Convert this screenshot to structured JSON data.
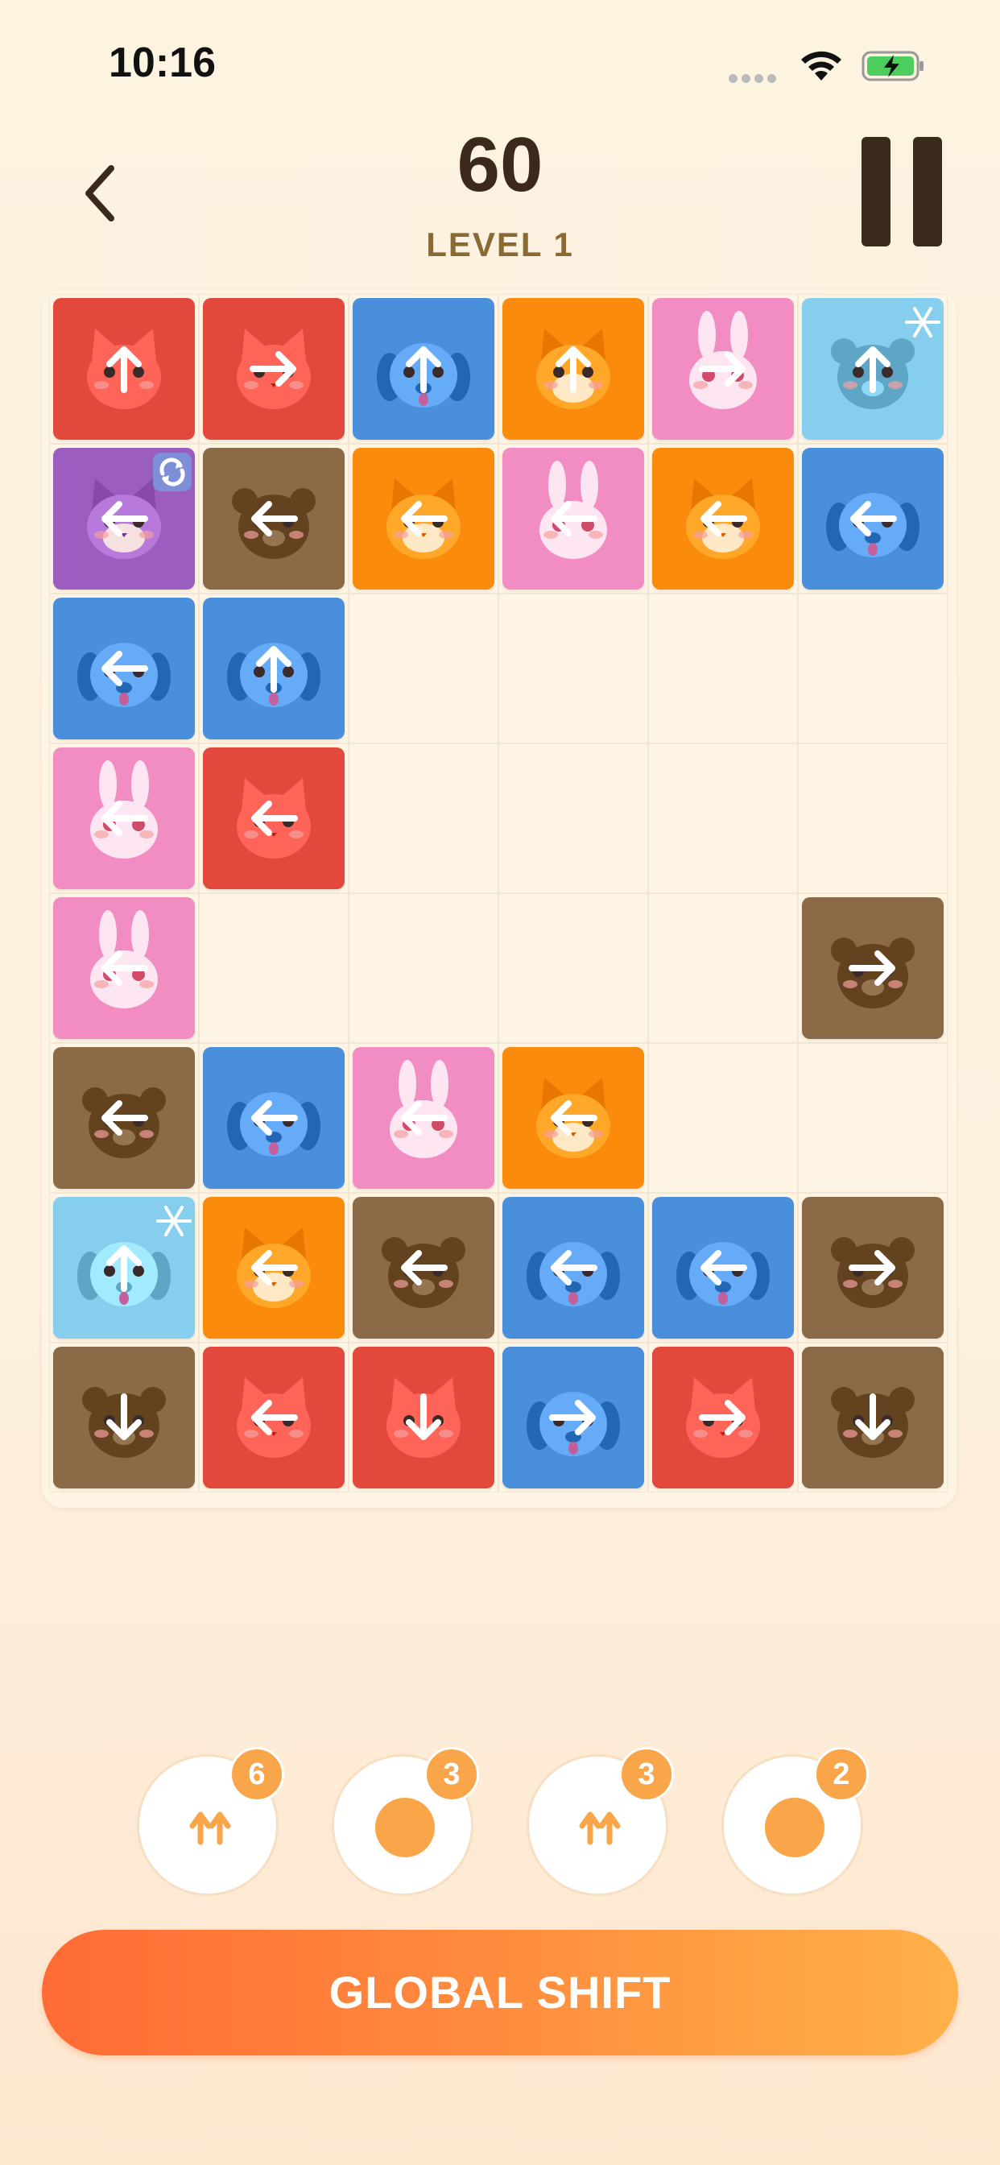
{
  "status": {
    "time": "10:16"
  },
  "header": {
    "score": "60",
    "level": "LEVEL 1"
  },
  "colors": {
    "red": "#e3483d",
    "blue": "#4a8fdc",
    "orange": "#fb8b0c",
    "pink": "#f18dc2",
    "lightblue": "#86ceed",
    "purple": "#9b5ec0",
    "brown": "#8b6a48"
  },
  "board": {
    "cols": 6,
    "rows": 8,
    "tiles": [
      {
        "row": 0,
        "col": 0,
        "animal": "cat",
        "color": "red",
        "dir": "up"
      },
      {
        "row": 0,
        "col": 1,
        "animal": "cat",
        "color": "red",
        "dir": "right"
      },
      {
        "row": 0,
        "col": 2,
        "animal": "dog",
        "color": "blue",
        "dir": "up"
      },
      {
        "row": 0,
        "col": 3,
        "animal": "fox",
        "color": "orange",
        "dir": "up"
      },
      {
        "row": 0,
        "col": 4,
        "animal": "bunny",
        "color": "pink",
        "dir": "right"
      },
      {
        "row": 0,
        "col": 5,
        "animal": "bear",
        "color": "lightblue",
        "dir": "up",
        "special": "frozen"
      },
      {
        "row": 1,
        "col": 0,
        "animal": "fox",
        "color": "purple",
        "dir": "left",
        "special": "rotate"
      },
      {
        "row": 1,
        "col": 1,
        "animal": "bear",
        "color": "brown",
        "dir": "left"
      },
      {
        "row": 1,
        "col": 2,
        "animal": "fox",
        "color": "orange",
        "dir": "left"
      },
      {
        "row": 1,
        "col": 3,
        "animal": "bunny",
        "color": "pink",
        "dir": "left"
      },
      {
        "row": 1,
        "col": 4,
        "animal": "fox",
        "color": "orange",
        "dir": "left"
      },
      {
        "row": 1,
        "col": 5,
        "animal": "dog",
        "color": "blue",
        "dir": "left"
      },
      {
        "row": 2,
        "col": 0,
        "animal": "dog",
        "color": "blue",
        "dir": "left"
      },
      {
        "row": 2,
        "col": 1,
        "animal": "dog",
        "color": "blue",
        "dir": "up"
      },
      {
        "row": 3,
        "col": 0,
        "animal": "bunny",
        "color": "pink",
        "dir": "left"
      },
      {
        "row": 3,
        "col": 1,
        "animal": "cat",
        "color": "red",
        "dir": "left"
      },
      {
        "row": 4,
        "col": 0,
        "animal": "bunny",
        "color": "pink",
        "dir": "left"
      },
      {
        "row": 4,
        "col": 5,
        "animal": "bear",
        "color": "brown",
        "dir": "right"
      },
      {
        "row": 5,
        "col": 0,
        "animal": "bear",
        "color": "brown",
        "dir": "left"
      },
      {
        "row": 5,
        "col": 1,
        "animal": "dog",
        "color": "blue",
        "dir": "left"
      },
      {
        "row": 5,
        "col": 2,
        "animal": "bunny",
        "color": "pink",
        "dir": "left"
      },
      {
        "row": 5,
        "col": 3,
        "animal": "fox",
        "color": "orange",
        "dir": "left"
      },
      {
        "row": 6,
        "col": 0,
        "animal": "dog",
        "color": "lightblue",
        "dir": "up",
        "special": "frozen"
      },
      {
        "row": 6,
        "col": 1,
        "animal": "fox",
        "color": "orange",
        "dir": "left"
      },
      {
        "row": 6,
        "col": 2,
        "animal": "bear",
        "color": "brown",
        "dir": "left"
      },
      {
        "row": 6,
        "col": 3,
        "animal": "dog",
        "color": "blue",
        "dir": "left"
      },
      {
        "row": 6,
        "col": 4,
        "animal": "dog",
        "color": "blue",
        "dir": "left"
      },
      {
        "row": 6,
        "col": 5,
        "animal": "bear",
        "color": "brown",
        "dir": "right"
      },
      {
        "row": 7,
        "col": 0,
        "animal": "bear",
        "color": "brown",
        "dir": "down"
      },
      {
        "row": 7,
        "col": 1,
        "animal": "cat",
        "color": "red",
        "dir": "left"
      },
      {
        "row": 7,
        "col": 2,
        "animal": "cat",
        "color": "red",
        "dir": "down"
      },
      {
        "row": 7,
        "col": 3,
        "animal": "dog",
        "color": "blue",
        "dir": "right"
      },
      {
        "row": 7,
        "col": 4,
        "animal": "cat",
        "color": "red",
        "dir": "right"
      },
      {
        "row": 7,
        "col": 5,
        "animal": "bear",
        "color": "brown",
        "dir": "down"
      }
    ]
  },
  "powerups": [
    {
      "icon": "double-up-arrow-icon",
      "count": "6"
    },
    {
      "icon": "dot-icon",
      "count": "3"
    },
    {
      "icon": "double-up-arrow-icon",
      "count": "3"
    },
    {
      "icon": "dot-icon",
      "count": "2"
    }
  ],
  "action": {
    "label": "GLOBAL SHIFT"
  }
}
